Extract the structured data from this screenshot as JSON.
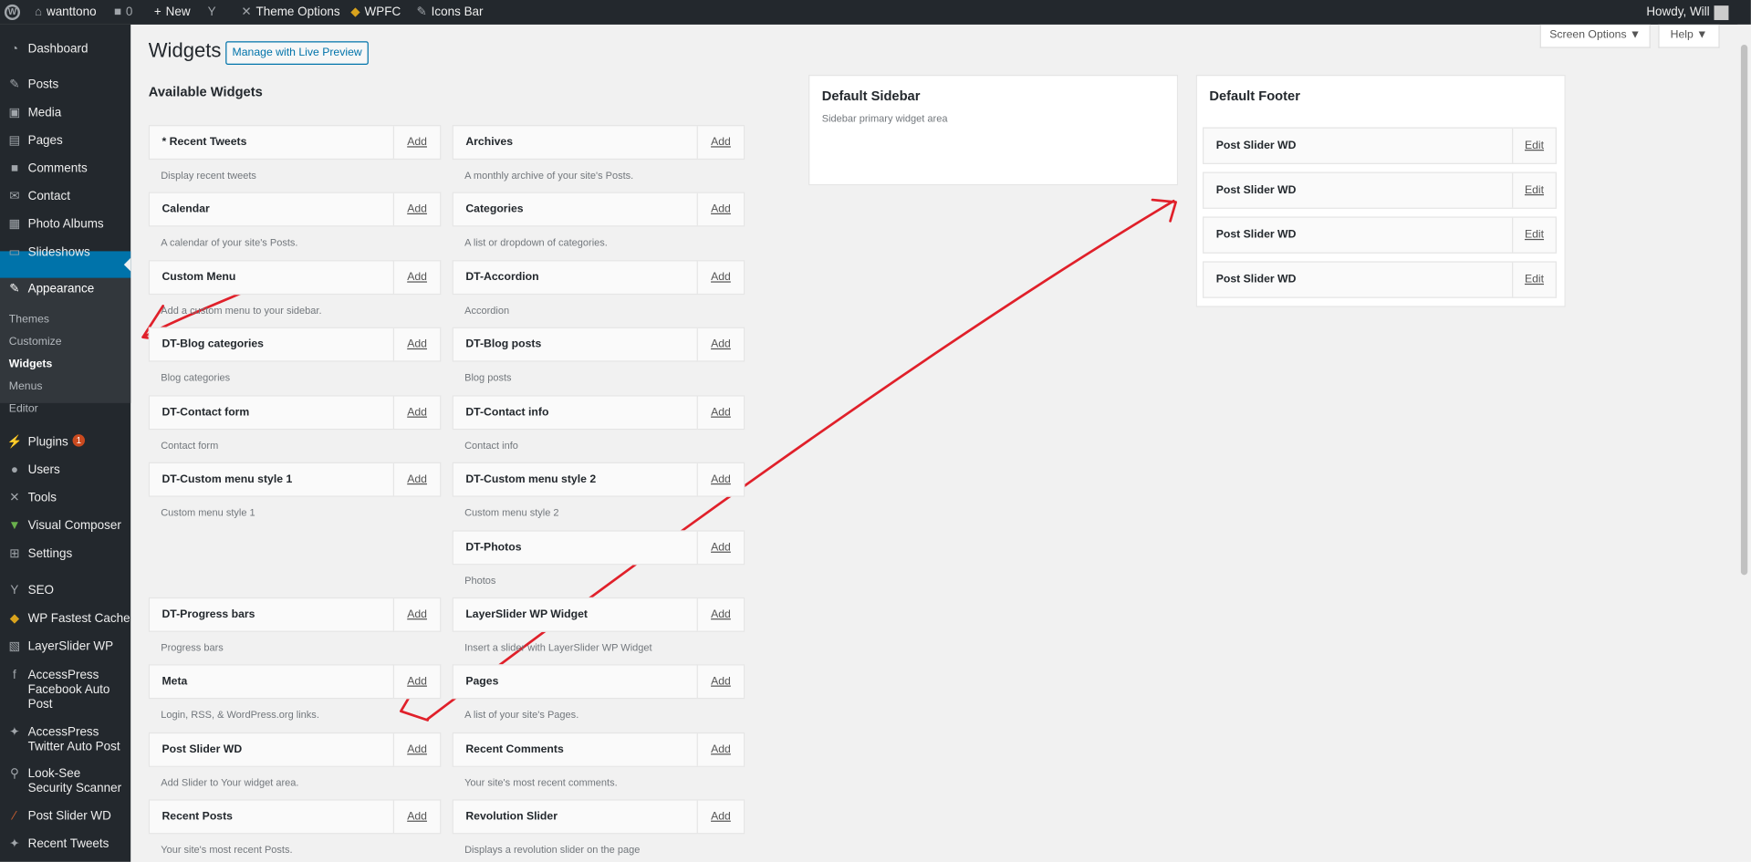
{
  "adminbar": {
    "site_name": "wanttono",
    "comments_count": "0",
    "new_label": "New",
    "theme_options_label": "Theme Options",
    "wpfc_label": "WPFC",
    "icons_bar_label": "Icons Bar",
    "howdy_label": "Howdy, Will"
  },
  "sidebar": {
    "dashboard": "Dashboard",
    "posts": "Posts",
    "media": "Media",
    "pages": "Pages",
    "comments": "Comments",
    "contact": "Contact",
    "photo_albums": "Photo Albums",
    "slideshows": "Slideshows",
    "appearance": "Appearance",
    "sub_themes": "Themes",
    "sub_customize": "Customize",
    "sub_widgets": "Widgets",
    "sub_menus": "Menus",
    "sub_editor": "Editor",
    "plugins": "Plugins",
    "plugins_badge": "1",
    "users": "Users",
    "tools": "Tools",
    "visual_composer": "Visual Composer",
    "settings": "Settings",
    "seo": "SEO",
    "wp_fastest_cache": "WP Fastest Cache",
    "layerslider": "LayerSlider WP",
    "accesspress_fb": "AccessPress Facebook Auto Post",
    "accesspress_tw": "AccessPress Twitter Auto Post",
    "look_see": "Look-See Security Scanner",
    "post_slider": "Post Slider WD",
    "recent_tweets": "Recent Tweets"
  },
  "header": {
    "title": "Widgets",
    "live_preview": "Manage with Live Preview",
    "screen_options": "Screen Options ▼",
    "help": "Help ▼"
  },
  "available": {
    "title": "Available Widgets",
    "add_label": "Add",
    "left": [
      {
        "name": "* Recent Tweets",
        "desc": "Display recent tweets"
      },
      {
        "name": "Calendar",
        "desc": "A calendar of your site's Posts."
      },
      {
        "name": "Custom Menu",
        "desc": "Add a custom menu to your sidebar."
      },
      {
        "name": "DT-Blog categories",
        "desc": "Blog categories"
      },
      {
        "name": "DT-Contact form",
        "desc": "Contact form"
      },
      {
        "name": "DT-Custom menu style 1",
        "desc": "Custom menu style 1"
      },
      {
        "name": "DT-Progress bars",
        "desc": "Progress bars"
      },
      {
        "name": "Meta",
        "desc": "Login, RSS, & WordPress.org links."
      },
      {
        "name": "Post Slider WD",
        "desc": "Add Slider to Your widget area."
      },
      {
        "name": "Recent Posts",
        "desc": "Your site's most recent Posts."
      }
    ],
    "right": [
      {
        "name": "Archives",
        "desc": "A monthly archive of your site's Posts."
      },
      {
        "name": "Categories",
        "desc": "A list or dropdown of categories."
      },
      {
        "name": "DT-Accordion",
        "desc": "Accordion"
      },
      {
        "name": "DT-Blog posts",
        "desc": "Blog posts"
      },
      {
        "name": "DT-Contact info",
        "desc": "Contact info"
      },
      {
        "name": "DT-Custom menu style 2",
        "desc": "Custom menu style 2"
      },
      {
        "name": "DT-Photos",
        "desc": "Photos"
      },
      {
        "name": "LayerSlider WP Widget",
        "desc": "Insert a slider with LayerSlider WP Widget"
      },
      {
        "name": "Pages",
        "desc": "A list of your site's Pages."
      },
      {
        "name": "Recent Comments",
        "desc": "Your site's most recent comments."
      },
      {
        "name": "Revolution Slider",
        "desc": "Displays a revolution slider on the page"
      }
    ]
  },
  "default_sidebar": {
    "title": "Default Sidebar",
    "desc": "Sidebar primary widget area"
  },
  "default_footer": {
    "title": "Default Footer",
    "edit_label": "Edit",
    "widgets": [
      "Post Slider WD",
      "Post Slider WD",
      "Post Slider WD",
      "Post Slider WD"
    ]
  },
  "colors": {
    "admin_bg": "#23282d",
    "accent": "#0073aa",
    "annotation": "#e0202a"
  }
}
